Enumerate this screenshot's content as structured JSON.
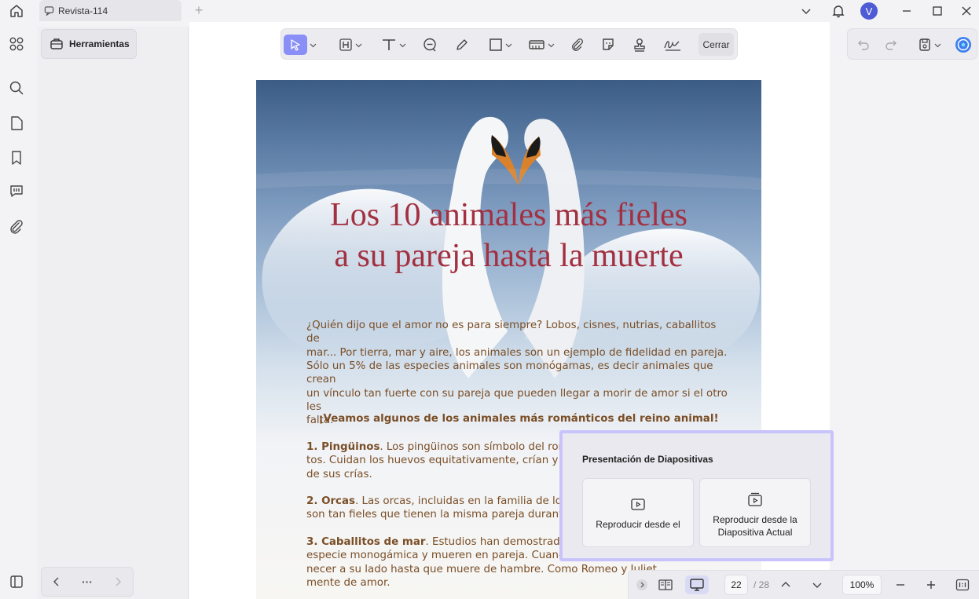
{
  "titlebar": {
    "tab_title": "Revista-114",
    "new_tab": "+",
    "avatar_letter": "V"
  },
  "sidepanel": {
    "tools_label": "Herramientas",
    "nav_more": "···"
  },
  "toolbar": {
    "close_label": "Cerrar"
  },
  "document": {
    "title_line1": "Los 10 animales más fieles",
    "title_line2": "a su pareja hasta la muerte",
    "p1_line1": "¿Quién dijo que el amor no es para siempre? Lobos, cisnes, nutrias, caballitos de",
    "p1_line2": "mar... Por tierra, mar y aire, los animales son un ejemplo de fidelidad en pareja.",
    "p2_line1": "Sólo un 5% de las especies animales son monógamas, es decir animales que crean",
    "p2_line2": "un vínculo tan fuerte con su pareja que pueden llegar a morir de amor si el otro les",
    "p2_line3": "falta.",
    "heading": "¡Veamos algunos de los animales más románticos del reino animal!",
    "i1_title": "1. Pingüinos",
    "i1_line1": ". Los pingüinos son símbolo del roman",
    "i1_line2": "tos. Cuidan los huevos equitativamente, crían y luc",
    "i1_line3": "de sus crías.",
    "i2_title": "2. Orcas",
    "i2_line1": ". Las orcas, incluidas en la familia de los d",
    "i2_line2": "son tan fieles que tienen la misma pareja durante to",
    "i3_title": "3. Caballitos de mar",
    "i3_line1": ". Estudios han demostrado qu",
    "i3_line2": "especie monogámica y mueren en pareja. Cuando u",
    "i3_line3": "necer a su lado hasta que muere de hambre. Como Romeo y Juliet",
    "i3_line4": "mente de amor."
  },
  "slideshow": {
    "title": "Presentación de Diapositivas",
    "option_start": "Reproducir desde el",
    "option_current_line1": "Reproducir desde la",
    "option_current_line2": "Diapositiva Actual"
  },
  "bottombar": {
    "current_page": "22",
    "total_pages": "/ 28",
    "zoom": "100%"
  }
}
